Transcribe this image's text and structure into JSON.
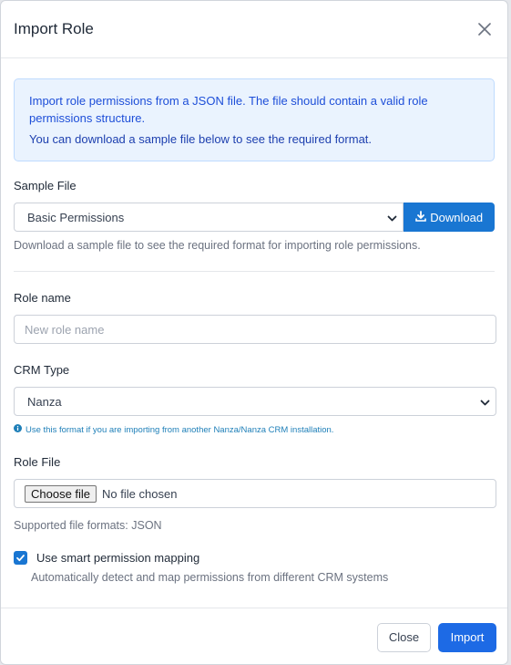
{
  "modal": {
    "title": "Import Role"
  },
  "alert": {
    "line1": "Import role permissions from a JSON file. The file should contain a valid role permissions structure.",
    "line2": "You can download a sample file below to see the required format."
  },
  "sample": {
    "label": "Sample File",
    "selected": "Basic Permissions",
    "download_label": "Download",
    "help": "Download a sample file to see the required format for importing role permissions."
  },
  "role_name": {
    "label": "Role name",
    "placeholder": "New role name",
    "value": ""
  },
  "crm_type": {
    "label": "CRM Type",
    "selected": "Nanza",
    "info": "Use this format if you are importing from another Nanza/Nanza CRM installation."
  },
  "role_file": {
    "label": "Role File",
    "button_label": "Choose file",
    "status": "No file chosen",
    "formats": "Supported file formats: JSON"
  },
  "smart_mapping": {
    "label": "Use smart permission mapping",
    "checked": true,
    "help": "Automatically detect and map permissions from different CRM systems"
  },
  "footer": {
    "close_label": "Close",
    "import_label": "Import"
  },
  "colors": {
    "primary": "#1976d2",
    "import": "#1d6ae5",
    "alert_bg": "#eaf3fe",
    "alert_text": "#1d4ed8",
    "info_text": "#1e7fb8"
  },
  "icons": {
    "close": "close-icon",
    "download": "download-icon",
    "chevron": "chevron-down-icon",
    "info": "info-icon",
    "check": "check-icon"
  }
}
